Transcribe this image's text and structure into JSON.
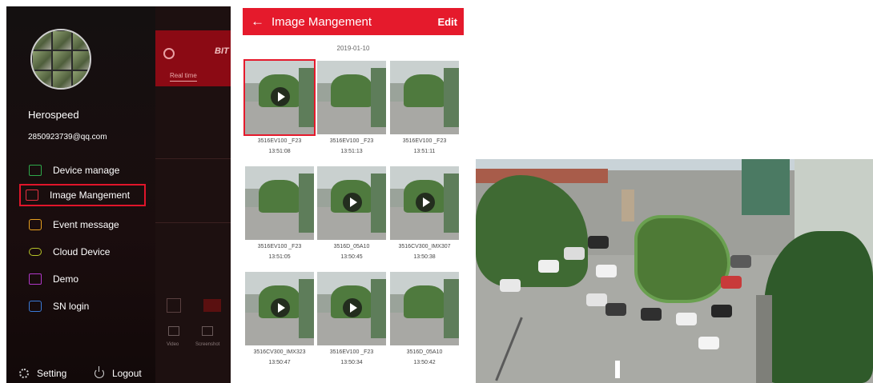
{
  "drawer": {
    "user_name": "Herospeed",
    "user_email": "2850923739@qq.com",
    "menu": [
      {
        "label": "Device manage",
        "icon": "camera-icon",
        "active": false
      },
      {
        "label": "Image Mangement",
        "icon": "image-icon",
        "active": true
      },
      {
        "label": "Event message",
        "icon": "message-icon",
        "active": false
      },
      {
        "label": "Cloud Device",
        "icon": "cloud-icon",
        "active": false
      },
      {
        "label": "Demo",
        "icon": "demo-icon",
        "active": false
      },
      {
        "label": "SN login",
        "icon": "sn-login-icon",
        "active": false
      }
    ],
    "setting_label": "Setting",
    "logout_label": "Logout"
  },
  "background_app": {
    "title": "BIT",
    "tab": "Real time",
    "bottom_labels": [
      "Video",
      "Screenshot"
    ]
  },
  "image_management": {
    "title": "Image Mangement",
    "edit_label": "Edit",
    "date": "2019-01-10",
    "items": [
      {
        "name": "3516EV100 _F23",
        "time": "13:51:08",
        "video": true,
        "selected": true
      },
      {
        "name": "3516EV100 _F23",
        "time": "13:51:13",
        "video": false,
        "selected": false
      },
      {
        "name": "3516EV100 _F23",
        "time": "13:51:11",
        "video": false,
        "selected": false
      },
      {
        "name": "3516EV100 _F23",
        "time": "13:51:05",
        "video": false,
        "selected": false
      },
      {
        "name": "3516D_05A10",
        "time": "13:50:45",
        "video": true,
        "selected": false
      },
      {
        "name": "3516CV300_IMX307",
        "time": "13:50:38",
        "video": true,
        "selected": false
      },
      {
        "name": "3516CV300_IMX323",
        "time": "13:50:47",
        "video": true,
        "selected": false
      },
      {
        "name": "3516EV100 _F23",
        "time": "13:50:34",
        "video": true,
        "selected": false
      },
      {
        "name": "3516D_05A10",
        "time": "13:50:42",
        "video": false,
        "selected": false
      }
    ]
  },
  "colors": {
    "accent_red": "#e51a2c",
    "drawer_bg": "#141010"
  }
}
